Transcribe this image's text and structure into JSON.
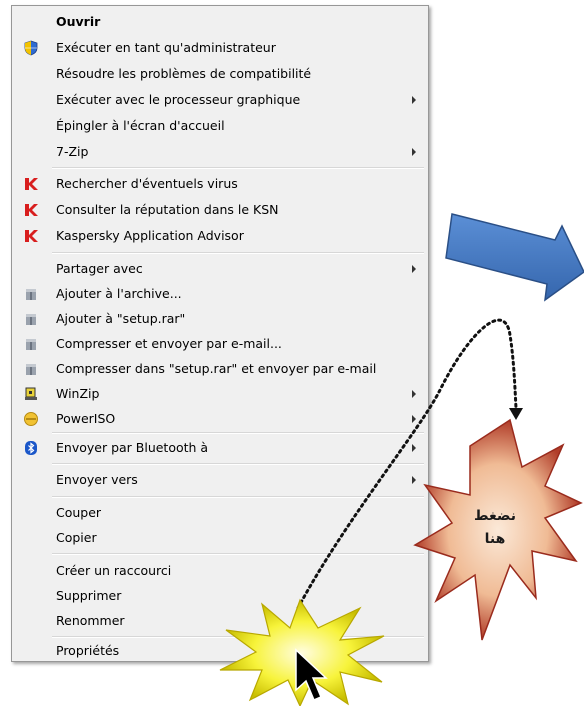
{
  "context_menu": {
    "items": [
      {
        "label": "Ouvrir",
        "icon": "",
        "submenu": false,
        "bold": true
      },
      {
        "label": "Exécuter en tant qu'administrateur",
        "icon": "uac-shield-icon",
        "submenu": false
      },
      {
        "label": "Résoudre les problèmes de compatibilité",
        "icon": "",
        "submenu": false
      },
      {
        "label": "Exécuter avec le processeur graphique",
        "icon": "",
        "submenu": true
      },
      {
        "label": "Épingler à l'écran d'accueil",
        "icon": "",
        "submenu": false
      },
      {
        "label": "7-Zip",
        "icon": "",
        "submenu": true
      },
      {
        "label": "Rechercher d'éventuels virus",
        "icon": "kaspersky-icon",
        "submenu": false
      },
      {
        "label": "Consulter la réputation dans le KSN",
        "icon": "kaspersky-icon",
        "submenu": false
      },
      {
        "label": "Kaspersky Application Advisor",
        "icon": "kaspersky-icon",
        "submenu": false
      },
      {
        "label": "Partager avec",
        "icon": "",
        "submenu": true
      },
      {
        "label": "Ajouter à l'archive...",
        "icon": "winrar-icon",
        "submenu": false
      },
      {
        "label": "Ajouter à \"setup.rar\"",
        "icon": "winrar-icon",
        "submenu": false
      },
      {
        "label": "Compresser et envoyer par e-mail...",
        "icon": "winrar-icon",
        "submenu": false
      },
      {
        "label": "Compresser dans \"setup.rar\" et envoyer par e-mail",
        "icon": "winrar-icon",
        "submenu": false
      },
      {
        "label": "WinZip",
        "icon": "winzip-icon",
        "submenu": true
      },
      {
        "label": "PowerISO",
        "icon": "poweriso-icon",
        "submenu": true
      },
      {
        "label": "Envoyer par Bluetooth à",
        "icon": "bluetooth-icon",
        "submenu": true
      },
      {
        "label": "Envoyer vers",
        "icon": "",
        "submenu": true
      },
      {
        "label": "Couper",
        "icon": "",
        "submenu": false
      },
      {
        "label": "Copier",
        "icon": "",
        "submenu": false
      },
      {
        "label": "Créer un raccourci",
        "icon": "",
        "submenu": false
      },
      {
        "label": "Supprimer",
        "icon": "",
        "submenu": false
      },
      {
        "label": "Renommer",
        "icon": "",
        "submenu": false
      },
      {
        "label": "Propriétés",
        "icon": "",
        "submenu": false
      }
    ]
  },
  "annotation": {
    "starburst_text_line1": "نضغط",
    "starburst_text_line2": "هنا"
  },
  "colors": {
    "menu_bg": "#f0f0f0",
    "arrow_blue": "#4f7fc2",
    "starburst_red": "#e0a07a",
    "highlight_yellow": "#f4ee3a"
  }
}
